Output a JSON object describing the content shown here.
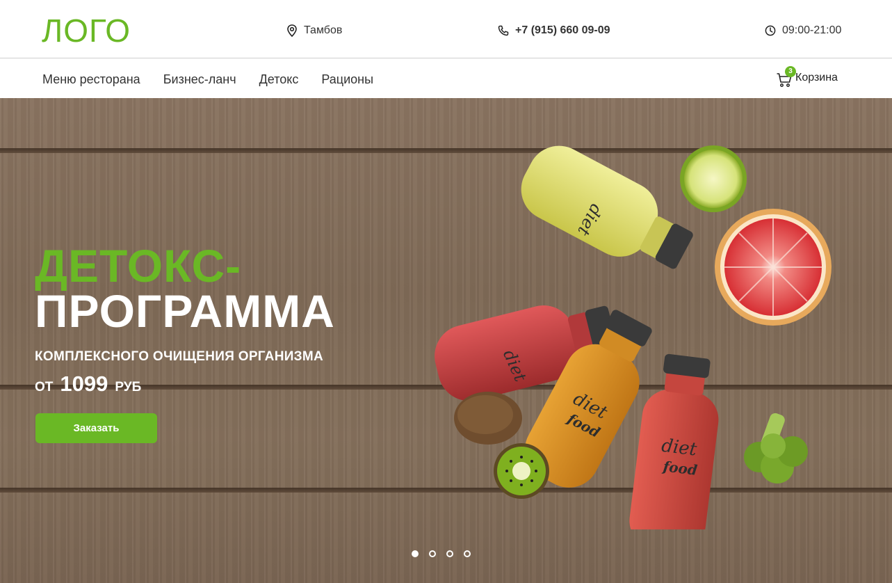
{
  "header": {
    "logo": "ЛОГО",
    "city": "Тамбов",
    "phone": "+7 (915) 660 09-09",
    "hours": "09:00-21:00"
  },
  "nav": {
    "items": [
      "Меню ресторана",
      "Бизнес-ланч",
      "Детокс",
      "Рационы"
    ],
    "cart_label": "Корзина",
    "cart_count": "3"
  },
  "hero": {
    "title_line1": "ДЕТОКС-",
    "title_line2": "ПРОГРАММА",
    "subtitle": "КОМПЛЕКСНОГО ОЧИЩЕНИЯ ОРГАНИЗМА",
    "price_prefix": "ОТ",
    "price_value": "1099",
    "price_currency": "РУБ",
    "button_label": "Заказать",
    "bottle_brand_top": "diet",
    "bottle_brand_bottom": "food",
    "slides_total": 4,
    "active_slide": 1
  },
  "colors": {
    "accent": "#6ab825",
    "text": "#333333",
    "wood": "#85705c"
  },
  "icons": {
    "city": "location-pin-icon",
    "phone": "phone-icon",
    "hours": "clock-icon",
    "cart": "cart-icon"
  }
}
